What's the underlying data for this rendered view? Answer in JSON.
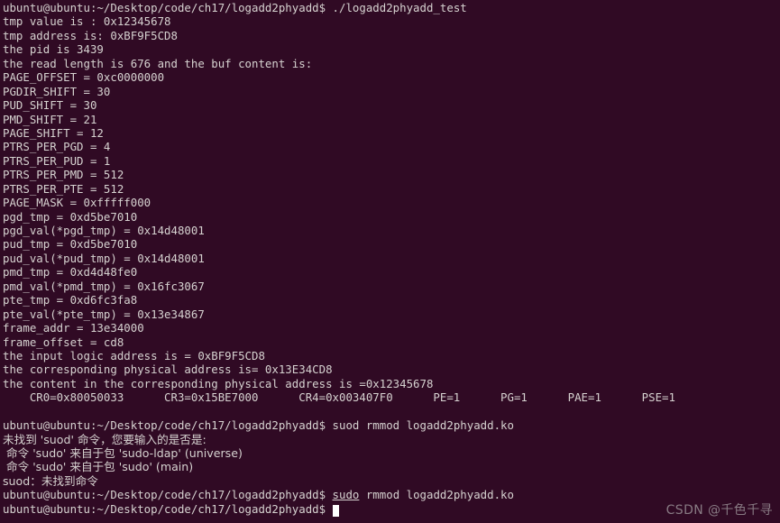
{
  "terminal": {
    "background_color": "#300a24",
    "foreground_color": "#d6d2d0",
    "cursor_color": "#ffffff",
    "prompt": "ubuntu@ubuntu:~/Desktop/code/ch17/logadd2phyadd$",
    "lines": [
      {
        "id": "l0",
        "type": "prompt",
        "prompt": "ubuntu@ubuntu:~/Desktop/code/ch17/logadd2phyadd$",
        "command": " ./logadd2phyadd_test"
      },
      {
        "id": "l1",
        "type": "output",
        "text": "tmp value is : 0x12345678"
      },
      {
        "id": "l2",
        "type": "output",
        "text": "tmp address is: 0xBF9F5CD8"
      },
      {
        "id": "l3",
        "type": "output",
        "text": "the pid is 3439"
      },
      {
        "id": "l4",
        "type": "output",
        "text": "the read length is 676 and the buf content is:"
      },
      {
        "id": "l5",
        "type": "output",
        "text": "PAGE_OFFSET = 0xc0000000"
      },
      {
        "id": "l6",
        "type": "output",
        "text": "PGDIR_SHIFT = 30"
      },
      {
        "id": "l7",
        "type": "output",
        "text": "PUD_SHIFT = 30"
      },
      {
        "id": "l8",
        "type": "output",
        "text": "PMD_SHIFT = 21"
      },
      {
        "id": "l9",
        "type": "output",
        "text": "PAGE_SHIFT = 12"
      },
      {
        "id": "l10",
        "type": "output",
        "text": "PTRS_PER_PGD = 4"
      },
      {
        "id": "l11",
        "type": "output",
        "text": "PTRS_PER_PUD = 1"
      },
      {
        "id": "l12",
        "type": "output",
        "text": "PTRS_PER_PMD = 512"
      },
      {
        "id": "l13",
        "type": "output",
        "text": "PTRS_PER_PTE = 512"
      },
      {
        "id": "l14",
        "type": "output",
        "text": "PAGE_MASK = 0xfffff000"
      },
      {
        "id": "l15",
        "type": "output",
        "text": "pgd_tmp = 0xd5be7010"
      },
      {
        "id": "l16",
        "type": "output",
        "text": "pgd_val(*pgd_tmp) = 0x14d48001"
      },
      {
        "id": "l17",
        "type": "output",
        "text": "pud_tmp = 0xd5be7010"
      },
      {
        "id": "l18",
        "type": "output",
        "text": "pud_val(*pud_tmp) = 0x14d48001"
      },
      {
        "id": "l19",
        "type": "output",
        "text": "pmd_tmp = 0xd4d48fe0"
      },
      {
        "id": "l20",
        "type": "output",
        "text": "pmd_val(*pmd_tmp) = 0x16fc3067"
      },
      {
        "id": "l21",
        "type": "output",
        "text": "pte_tmp = 0xd6fc3fa8"
      },
      {
        "id": "l22",
        "type": "output",
        "text": "pte_val(*pte_tmp) = 0x13e34867"
      },
      {
        "id": "l23",
        "type": "output",
        "text": "frame_addr = 13e34000"
      },
      {
        "id": "l24",
        "type": "output",
        "text": "frame_offset = cd8"
      },
      {
        "id": "l25",
        "type": "output",
        "text": "the input logic address is = 0xBF9F5CD8"
      },
      {
        "id": "l26",
        "type": "output",
        "text": "the corresponding physical address is= 0x13E34CD8"
      },
      {
        "id": "l27",
        "type": "output",
        "text": "the content in the corresponding physical address is =0x12345678"
      },
      {
        "id": "l28",
        "type": "output",
        "text": "    CR0=0x80050033      CR3=0x15BE7000      CR4=0x003407F0      PE=1      PG=1      PAE=1      PSE=1"
      },
      {
        "id": "l29",
        "type": "blank",
        "text": ""
      },
      {
        "id": "l30",
        "type": "prompt",
        "prompt": "ubuntu@ubuntu:~/Desktop/code/ch17/logadd2phyadd$",
        "command": " suod rmmod logadd2phyadd.ko"
      },
      {
        "id": "l31",
        "type": "cjk",
        "text": "未找到 'suod' 命令，您要输入的是否是:"
      },
      {
        "id": "l32",
        "type": "cjk",
        "text": " 命令 'sudo' 来自于包 'sudo-ldap' (universe)"
      },
      {
        "id": "l33",
        "type": "cjk",
        "text": " 命令 'sudo' 来自于包 'sudo' (main)"
      },
      {
        "id": "l34",
        "type": "cjk",
        "text": "suod：未找到命令"
      },
      {
        "id": "l35",
        "type": "prompt-underline",
        "prompt": "ubuntu@ubuntu:~/Desktop/code/ch17/logadd2phyadd$",
        "command_pre": " ",
        "command_underlined": "sudo",
        "command_post": " rmmod logadd2phyadd.ko"
      },
      {
        "id": "l36",
        "type": "prompt-cursor",
        "prompt": "ubuntu@ubuntu:~/Desktop/code/ch17/logadd2phyadd$",
        "command": " "
      }
    ]
  },
  "watermark": {
    "text": "CSDN @千色千寻",
    "color": "#8d8189"
  }
}
